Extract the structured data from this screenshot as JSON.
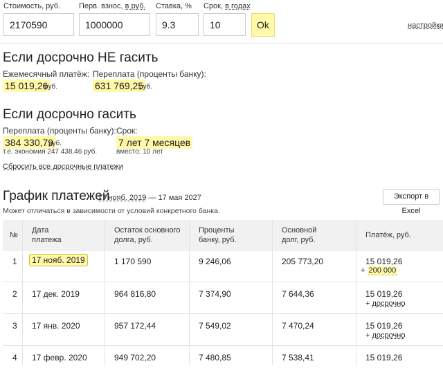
{
  "inputs": {
    "price_label": "Стоимость, руб.",
    "price_value": "2170590",
    "down_label_prefix": "Перв. взнос, ",
    "down_label_unit": "в руб.",
    "down_value": "1000000",
    "rate_label": "Ставка, %",
    "rate_value": "9.3",
    "term_label_prefix": "Срок, ",
    "term_label_unit": "в годах",
    "term_value": "10",
    "ok_label": "Ok",
    "settings_label": "настройки"
  },
  "no_early": {
    "heading": "Если досрочно НЕ гасить",
    "monthly_label": "Ежемесячный платёж:",
    "monthly_value": "15 019,26",
    "monthly_unit": "руб.",
    "overpay_label": "Переплата (проценты банку):",
    "overpay_value": "631 769,25",
    "overpay_unit": "руб."
  },
  "early": {
    "heading": "Если досрочно гасить",
    "overpay_label": "Переплата (проценты банку):",
    "overpay_value": "384 330,79",
    "overpay_unit": "руб.",
    "savings": "т.е. экономия 247 438,46 руб.",
    "term_label": "Срок:",
    "term_value": "7 лет 7 месяцев",
    "term_instead": "вместо: 10 лет",
    "reset_link": "Сбросить все досрочные платежи"
  },
  "schedule": {
    "heading": "График платежей",
    "date_start": "17 нояб. 2019",
    "date_sep": " — ",
    "date_end": "17 мая 2027",
    "note": "Может отличаться в зависимости от условий конкретного банка.",
    "export_label": "Экспорт в Excel",
    "columns": {
      "num": "№",
      "date": "Дата\nплатежа",
      "balance": "Остаток основного\nдолга, руб.",
      "interest": "Проценты\nбанку, руб.",
      "principal": "Основной\nдолг, руб.",
      "payment": "Платёж, руб."
    },
    "rows": [
      {
        "num": "1",
        "date": "17 нояб. 2019",
        "balance": "1 170 590",
        "interest": "9 246,06",
        "principal": "205 773,20",
        "payment": "15 019,26",
        "extra_sign": "+",
        "extra": "200 000"
      },
      {
        "num": "2",
        "date": "17 дек. 2019",
        "balance": "964 816,80",
        "interest": "7 374,90",
        "principal": "7 644,36",
        "payment": "15 019,26",
        "extra_sign": "+",
        "extra": "досрочно"
      },
      {
        "num": "3",
        "date": "17 янв. 2020",
        "balance": "957 172,44",
        "interest": "7 549,02",
        "principal": "7 470,24",
        "payment": "15 019,26",
        "extra_sign": "+",
        "extra": "досрочно"
      },
      {
        "num": "4",
        "date": "17 февр. 2020",
        "balance": "949 702,20",
        "interest": "7 480,85",
        "principal": "7 538,41",
        "payment": "15 019,26"
      }
    ]
  }
}
